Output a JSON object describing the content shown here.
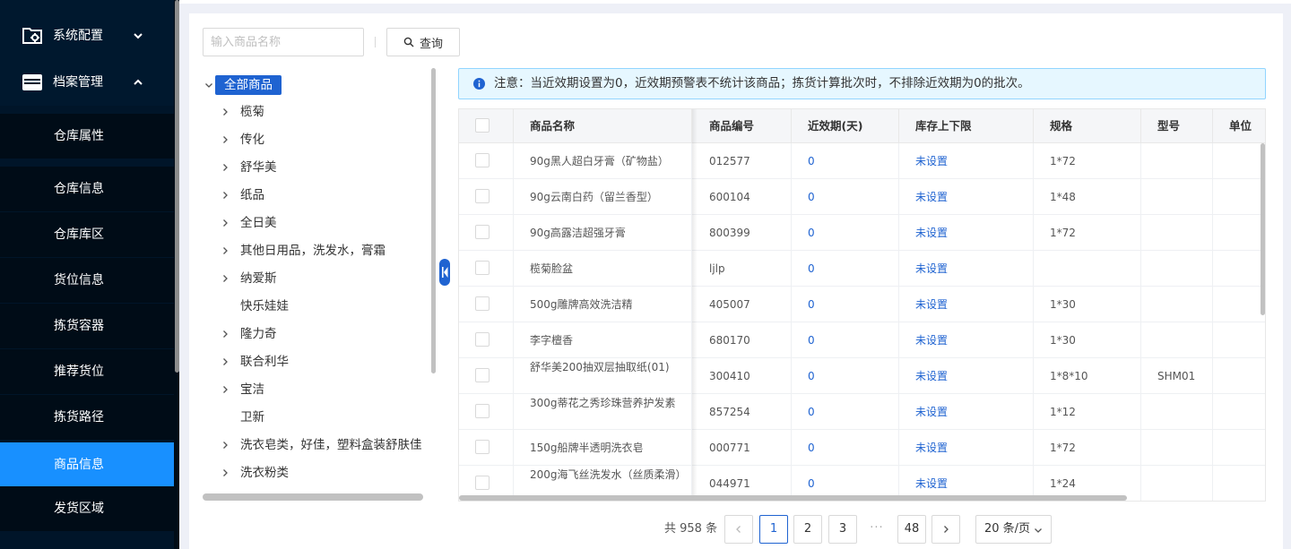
{
  "sidebar": {
    "groups": [
      {
        "label": "系统配置",
        "icon": "folder-gear-icon",
        "expanded": false
      },
      {
        "label": "档案管理",
        "icon": "archive-box-icon",
        "expanded": true
      }
    ],
    "items": [
      {
        "label": "仓库属性"
      },
      {
        "label": "仓库信息"
      },
      {
        "label": "仓库库区"
      },
      {
        "label": "货位信息"
      },
      {
        "label": "拣货容器"
      },
      {
        "label": "推荐货位"
      },
      {
        "label": "拣货路径"
      },
      {
        "label": "商品信息",
        "active": true
      },
      {
        "label": "发货区域"
      }
    ],
    "active_color": "#1890ff"
  },
  "search": {
    "placeholder": "输入商品名称",
    "query_label": "查询"
  },
  "tree": {
    "root_label": "全部商品",
    "nodes": [
      {
        "label": "榄菊",
        "has_children": true
      },
      {
        "label": "传化",
        "has_children": true
      },
      {
        "label": "舒华美",
        "has_children": true
      },
      {
        "label": "纸品",
        "has_children": true
      },
      {
        "label": "全日美",
        "has_children": true
      },
      {
        "label": "其他日用品，洗发水，膏霜",
        "has_children": true
      },
      {
        "label": "纳爱斯",
        "has_children": true
      },
      {
        "label": "快乐娃娃",
        "has_children": false
      },
      {
        "label": "隆力奇",
        "has_children": true
      },
      {
        "label": "联合利华",
        "has_children": true
      },
      {
        "label": "宝洁",
        "has_children": true
      },
      {
        "label": "卫新",
        "has_children": false
      },
      {
        "label": "洗衣皂类，好佳，塑料盒装舒肤佳",
        "has_children": true
      },
      {
        "label": "洗衣粉类",
        "has_children": true
      }
    ]
  },
  "notice": {
    "text": "注意：当近效期设置为0，近效期预警表不统计该商品；拣货计算批次时，不排除近效期为0的批次。"
  },
  "table": {
    "columns": [
      "商品名称",
      "商品编号",
      "近效期(天)",
      "库存上下限",
      "规格",
      "型号",
      "单位"
    ],
    "rows": [
      {
        "name": "90g黑人超白牙膏（矿物盐）",
        "code": "012577",
        "expiry": "0",
        "limit": "未设置",
        "spec": "1*72",
        "model": "",
        "unit": ""
      },
      {
        "name": "90g云南白药（留兰香型）",
        "code": "600104",
        "expiry": "0",
        "limit": "未设置",
        "spec": "1*48",
        "model": "",
        "unit": ""
      },
      {
        "name": "90g高露洁超强牙膏",
        "code": "800399",
        "expiry": "0",
        "limit": "未设置",
        "spec": "1*72",
        "model": "",
        "unit": ""
      },
      {
        "name": "榄菊脸盆",
        "code": "ljlp",
        "expiry": "0",
        "limit": "未设置",
        "spec": "",
        "model": "",
        "unit": ""
      },
      {
        "name": "500g雕牌高效洗洁精",
        "code": "405007",
        "expiry": "0",
        "limit": "未设置",
        "spec": "1*30",
        "model": "",
        "unit": ""
      },
      {
        "name": "李字檀香",
        "code": "680170",
        "expiry": "0",
        "limit": "未设置",
        "spec": "1*30",
        "model": "",
        "unit": ""
      },
      {
        "name": "舒华美200抽双层抽取纸(01)",
        "code": "300410",
        "expiry": "0",
        "limit": "未设置",
        "spec": "1*8*10",
        "model": "SHM01",
        "unit": ""
      },
      {
        "name": "300g蒂花之秀珍珠营养护发素",
        "code": "857254",
        "expiry": "0",
        "limit": "未设置",
        "spec": "1*12",
        "model": "",
        "unit": ""
      },
      {
        "name": "150g船牌半透明洗衣皂",
        "code": "000771",
        "expiry": "0",
        "limit": "未设置",
        "spec": "1*72",
        "model": "",
        "unit": ""
      },
      {
        "name": "200g海飞丝洗发水（丝质柔滑）",
        "code": "044971",
        "expiry": "0",
        "limit": "未设置",
        "spec": "1*24",
        "model": "",
        "unit": ""
      }
    ]
  },
  "pagination": {
    "total_text": "共 958 条",
    "pages": [
      "1",
      "2",
      "3"
    ],
    "ellipsis": "···",
    "last_page": "48",
    "current": "1",
    "page_size": "20 条/页"
  },
  "colors": {
    "primary": "#1f63d1",
    "sidebar_bg": "#001529",
    "notice_bg": "#e6f7ff"
  }
}
